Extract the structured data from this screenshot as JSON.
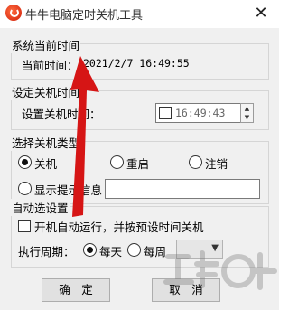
{
  "window": {
    "title": "牛牛电脑定时关机工具",
    "close_symbol": "✕"
  },
  "system_time": {
    "group_title": "系统当前时间",
    "label": "当前时间：",
    "value": "2021/2/7 16:49:55"
  },
  "set_shutdown": {
    "group_title": "设定关机时间",
    "label": "设置关机时间：",
    "time_value": "16:49:43",
    "time_enabled": false
  },
  "shutdown_type": {
    "group_title": "选择关机类型",
    "options": [
      {
        "label": "关机",
        "selected": true
      },
      {
        "label": "重启",
        "selected": false
      },
      {
        "label": "注销",
        "selected": false
      },
      {
        "label": "显示提示信息",
        "selected": false
      }
    ],
    "message_value": ""
  },
  "auto_options": {
    "group_title": "自动选设置",
    "autostart_label": "开机自动运行，并按预设时间关机",
    "autostart_checked": false,
    "period_label": "执行周期：",
    "periods": [
      {
        "label": "每天",
        "selected": true
      },
      {
        "label": "每周",
        "selected": false
      }
    ],
    "weekday_value": ""
  },
  "buttons": {
    "ok": "确　定",
    "cancel": "取　消"
  },
  "colors": {
    "arrow": "#d61515",
    "accent_icon": "#e0401b"
  },
  "icons": {
    "app": "clock-power-icon",
    "close": "close-icon",
    "dropdown": "chevron-down-icon"
  }
}
